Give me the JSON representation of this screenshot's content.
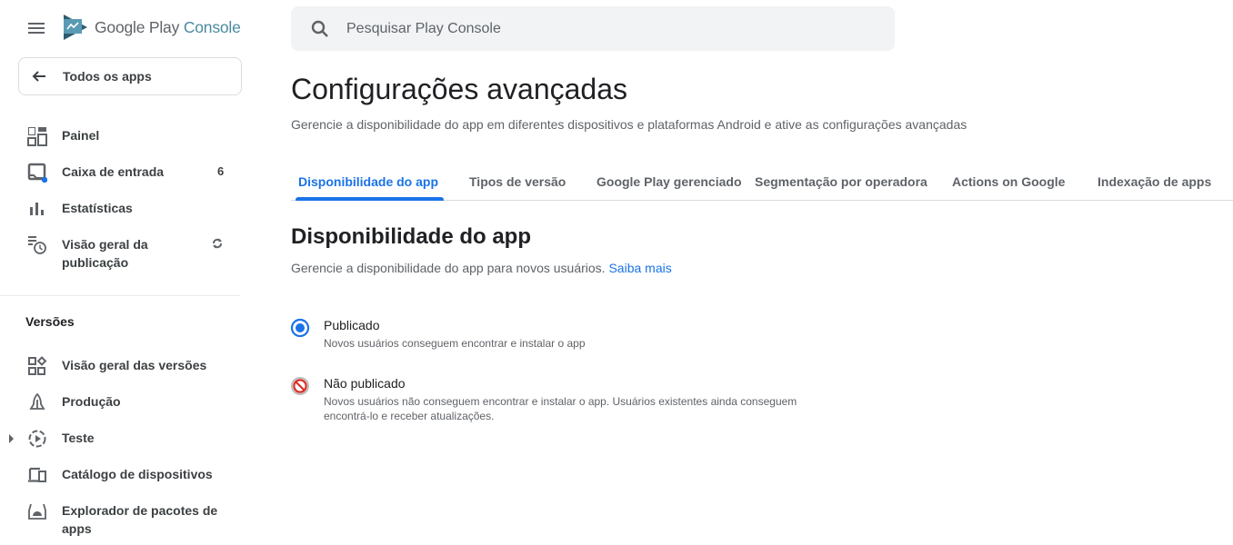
{
  "app": {
    "brand_google_play": "Google Play",
    "brand_console": "Console"
  },
  "sidebar": {
    "back_label": "Todos os apps",
    "items": [
      {
        "label": "Painel",
        "icon": "dashboard-icon"
      },
      {
        "label": "Caixa de entrada",
        "icon": "inbox-icon",
        "badge": "6"
      },
      {
        "label": "Estatísticas",
        "icon": "bar-chart-icon"
      },
      {
        "label": "Visão geral da publicação",
        "icon": "publishing-overview-icon",
        "status_icon": "sync-icon"
      }
    ],
    "section_title": "Versões",
    "release_items": [
      {
        "label": "Visão geral das versões",
        "icon": "releases-overview-icon"
      },
      {
        "label": "Produção",
        "icon": "rocket-icon"
      },
      {
        "label": "Teste",
        "icon": "testing-icon",
        "expandable": true
      },
      {
        "label": "Catálogo de dispositivos",
        "icon": "devices-icon"
      },
      {
        "label": "Explorador de pacotes de apps",
        "icon": "android-bundle-icon"
      }
    ]
  },
  "search": {
    "placeholder": "Pesquisar Play Console",
    "value": ""
  },
  "page": {
    "title": "Configurações avançadas",
    "subtitle": "Gerencie a disponibilidade do app em diferentes dispositivos e plataformas Android e ative as configurações avançadas"
  },
  "tabs": [
    {
      "label": "Disponibilidade do app",
      "active": true
    },
    {
      "label": "Tipos de versão",
      "active": false
    },
    {
      "label": "Google Play gerenciado",
      "active": false
    },
    {
      "label": "Segmentação por operadora",
      "active": false
    },
    {
      "label": "Actions on Google",
      "active": false
    },
    {
      "label": "Indexação de apps",
      "active": false
    }
  ],
  "availability": {
    "heading": "Disponibilidade do app",
    "description": "Gerencie a disponibilidade do app para novos usuários.",
    "learn_more": "Saiba mais",
    "options": [
      {
        "title": "Publicado",
        "description": "Novos usuários conseguem encontrar e instalar o app",
        "selected": true
      },
      {
        "title": "Não publicado",
        "description": "Novos usuários não conseguem encontrar e instalar o app. Usuários existentes ainda conseguem encontrá-lo e receber atualizações.",
        "selected": false,
        "disabled": true
      }
    ]
  },
  "colors": {
    "accent": "#1a73e8",
    "disabled_red": "#d93025"
  }
}
